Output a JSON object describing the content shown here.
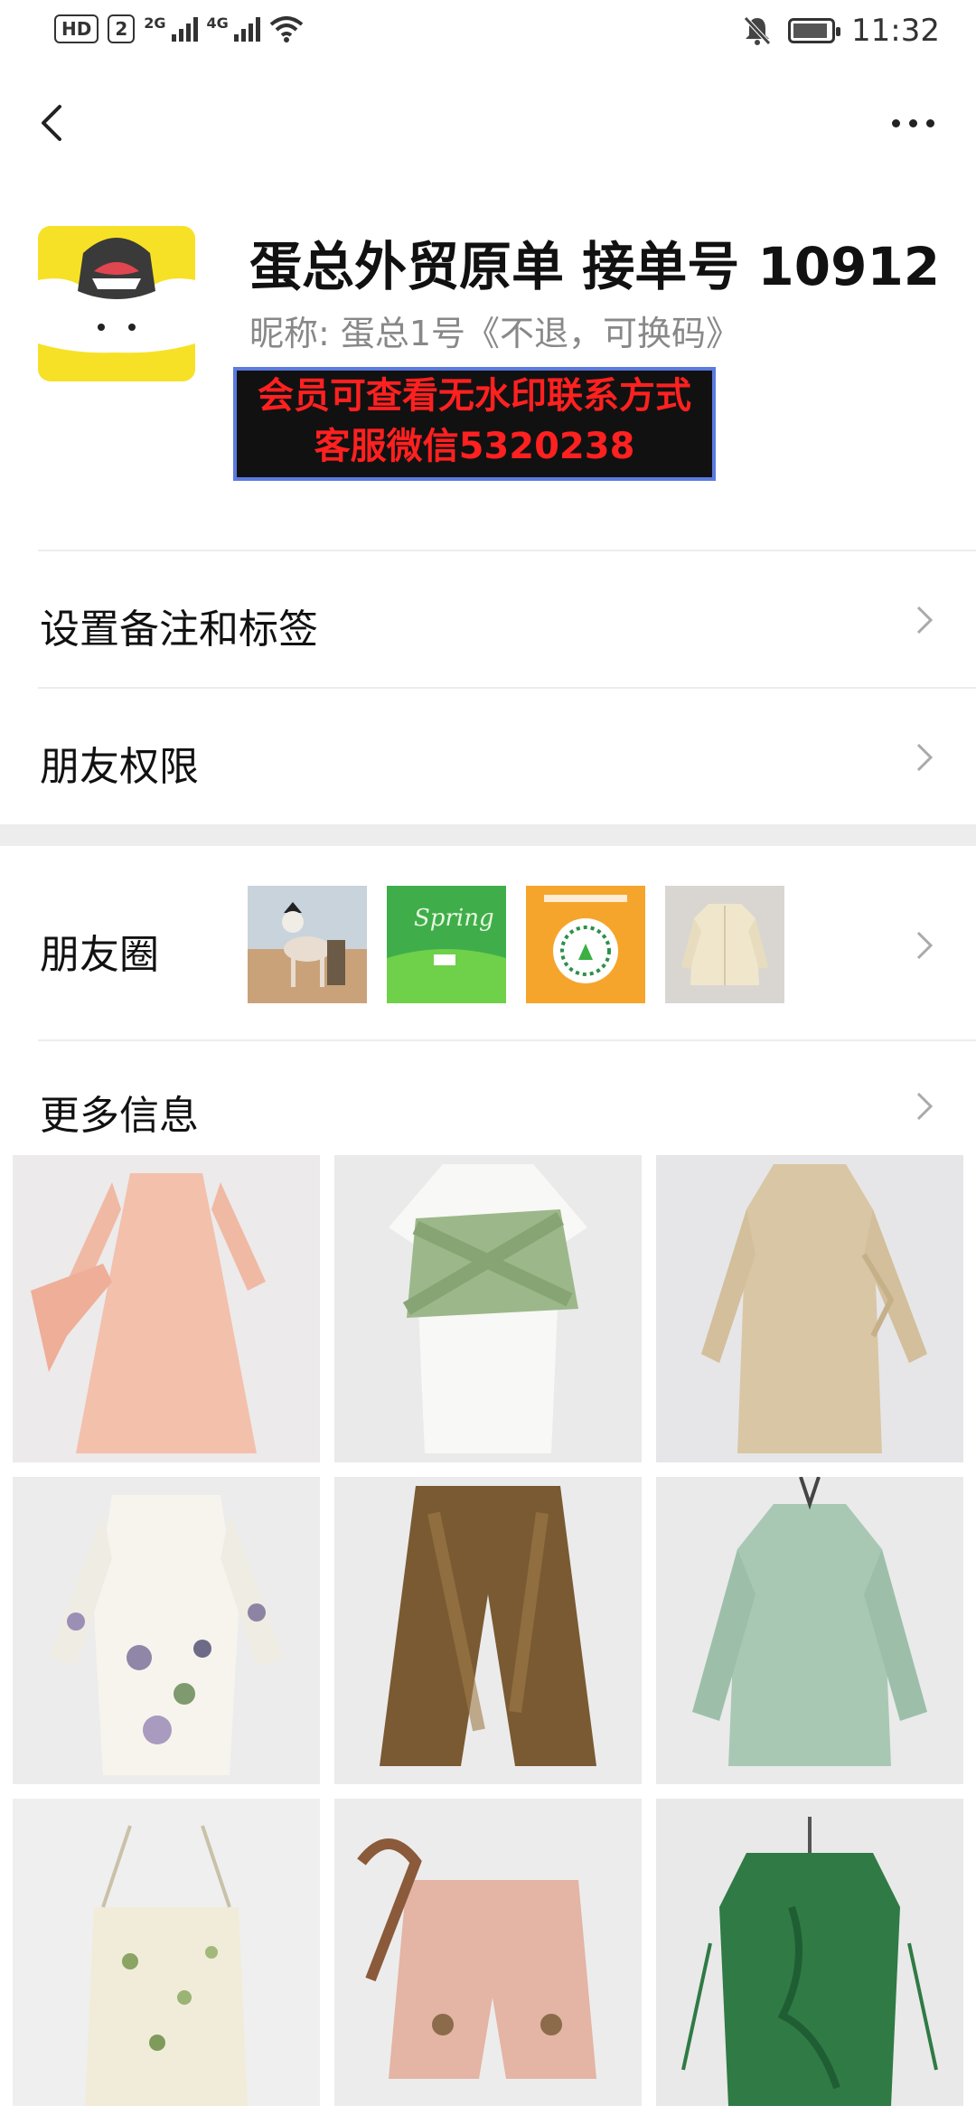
{
  "status_bar": {
    "hd_label": "HD",
    "sim_label": "2",
    "net1": "2G",
    "net2": "4G",
    "time": "11:32",
    "icons": [
      "signal-icon",
      "wifi-icon",
      "mute-bell-icon",
      "battery-icon"
    ]
  },
  "nav": {
    "icons": [
      "back-arrow-icon",
      "more-dots-icon"
    ]
  },
  "profile": {
    "name": "蛋总外贸原单 接单号 10912",
    "nickname": "昵称: 蛋总1号《不退，可换码》",
    "banner_line1": "会员可查看无水印联系方式",
    "banner_line2": "客服微信5320238",
    "banner_text_color": "#ff2020"
  },
  "menu": {
    "remarks_label": "设置备注和标签",
    "permissions_label": "朋友权限",
    "moments_label": "朋友圈",
    "more_info_label": "更多信息"
  },
  "moments_thumbs": [
    "dog-photo",
    "spring-grass-photo",
    "qr-poster",
    "cream-jacket-photo"
  ],
  "gallery": [
    "pink-dress",
    "white-green-wrap-dress",
    "beige-jacquard-dress",
    "floral-lilac-dress",
    "brown-velvet-pants",
    "sage-green-dress",
    "floral-camisole",
    "pink-embroidered-shorts",
    "green-embroidered-vest"
  ],
  "colors": {
    "accent_banner_border": "#5b7be0",
    "separator": "#ededed"
  }
}
